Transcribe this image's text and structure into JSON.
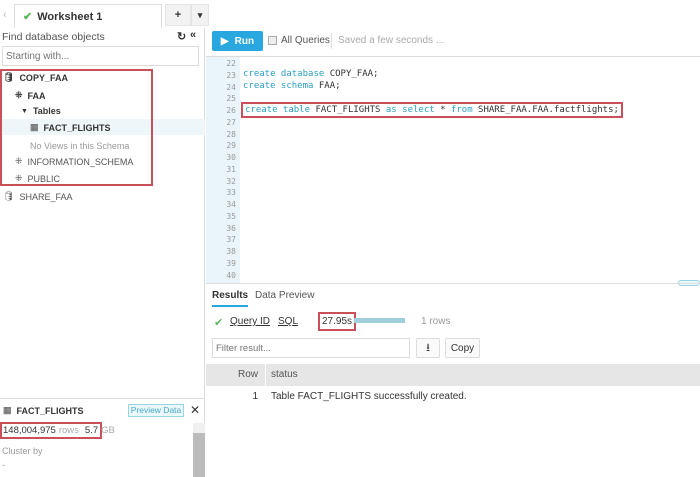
{
  "tabs": {
    "worksheet": "Worksheet 1",
    "add": "+",
    "menu": "▾",
    "back": "‹"
  },
  "left": {
    "title": "Find database objects",
    "search_placeholder": "Starting with...",
    "tree": [
      {
        "label": "COPY_FAA",
        "type": "database"
      },
      {
        "label": "FAA",
        "type": "schema"
      },
      {
        "label": "Tables",
        "type": "folder"
      },
      {
        "label": "FACT_FLIGHTS",
        "type": "table"
      },
      {
        "label": "No Views in this Schema",
        "type": "note"
      },
      {
        "label": "INFORMATION_SCHEMA",
        "type": "schema"
      },
      {
        "label": "PUBLIC",
        "type": "schema"
      },
      {
        "label": "SHARE_FAA",
        "type": "database-shared"
      }
    ],
    "details": {
      "name": "FACT_FLIGHTS",
      "preview": "Preview Data",
      "rows": "148,004,975",
      "rows_unit": "rows",
      "size": "5.7",
      "size_unit": "GB",
      "cluster_label": "Cluster by",
      "cluster_value": "-"
    }
  },
  "toolbar": {
    "run": "Run",
    "all_queries": "All Queries",
    "saved": "Saved a few seconds ..."
  },
  "editor": {
    "lines": [
      "22",
      "23",
      "24",
      "25",
      "26",
      "27",
      "28",
      "29",
      "30",
      "31",
      "32",
      "33",
      "34",
      "35",
      "36",
      "37",
      "38",
      "39",
      "40"
    ],
    "code": {
      "l23": {
        "kw": "create database",
        "rest": " COPY_FAA;"
      },
      "l24": {
        "kw": "create schema",
        "rest": " FAA;"
      },
      "l26": {
        "kw1": "create table",
        "t1": " FACT_FLIGHTS ",
        "kw2": "as select",
        "t2": " * ",
        "kw3": "from",
        "t3": " SHARE_FAA.FAA.factflights;"
      }
    }
  },
  "results": {
    "tabs": [
      "Results",
      "Data Preview"
    ],
    "query_id": "Query ID",
    "sql": "SQL",
    "duration": "27.95s",
    "progress": 1.0,
    "rows": "1 rows",
    "filter_placeholder": "Filter result...",
    "copy": "Copy",
    "columns": [
      "Row",
      "status"
    ],
    "data": [
      [
        "1",
        "Table FACT_FLIGHTS successfully created."
      ]
    ]
  },
  "colors": {
    "accent": "#29a8e0",
    "highlight": "#c9505a",
    "keyword": "#2aa0c4",
    "success": "#4caf50"
  }
}
